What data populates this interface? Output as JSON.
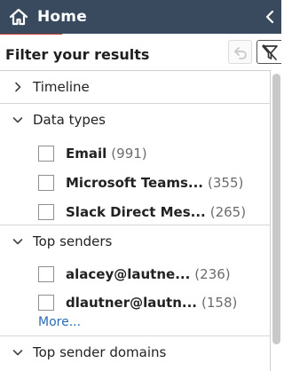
{
  "header": {
    "title": "Home",
    "icon": "home-icon",
    "collapse_icon": "chevron-left-icon"
  },
  "filter": {
    "title": "Filter your results",
    "undo_icon": "undo-icon",
    "funnel_icon": "funnel-clear-icon"
  },
  "sections": [
    {
      "label": "Timeline",
      "expanded": false
    },
    {
      "label": "Data types",
      "expanded": true,
      "items": [
        {
          "name": "Email",
          "count": "(991)"
        },
        {
          "name": "Microsoft Teams...",
          "count": "(355)"
        },
        {
          "name": "Slack Direct Mes...",
          "count": "(265)"
        }
      ]
    },
    {
      "label": "Top senders",
      "expanded": true,
      "items": [
        {
          "name": "alacey@lautne...",
          "count": "(236)"
        },
        {
          "name": "dlautner@lautn...",
          "count": "(158)"
        }
      ],
      "more_label": "More..."
    },
    {
      "label": "Top sender domains",
      "expanded": true
    }
  ],
  "colors": {
    "header_bg": "#3a4a5e",
    "link": "#2a6bb8",
    "accent_line": "#c4453a"
  }
}
